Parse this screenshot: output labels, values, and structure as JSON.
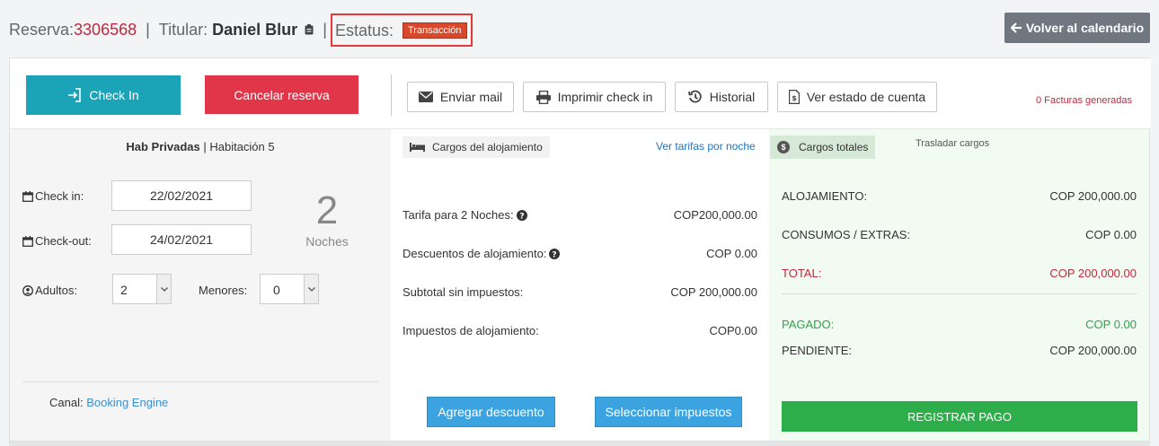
{
  "header": {
    "reserva_label": "Reserva:",
    "reserva_num": "3306568",
    "titular_label": "Titular:",
    "titular_name": "Daniel Blur",
    "estatus_label": "Estatus:",
    "estatus_badge": "Transacción",
    "separator": "|",
    "back_label": "Volver al calendario"
  },
  "toolbar": {
    "checkin_label": "Check In",
    "cancel_label": "Cancelar reserva",
    "mail_label": "Enviar mail",
    "print_label": "Imprimir check in",
    "history_label": "Historial",
    "account_label": "Ver estado de cuenta",
    "facturas": "0 Facturas generadas"
  },
  "left": {
    "room_type": "Hab Privadas",
    "room_sep": " | ",
    "room_name": "Habitación 5",
    "checkin_label": "Check in:",
    "checkin_value": "22/02/2021",
    "checkout_label": "Check-out:",
    "checkout_value": "24/02/2021",
    "nights_number": "2",
    "nights_label": "Noches",
    "adults_label": "Adultos:",
    "adults_value": "2",
    "minors_label": "Menores:",
    "minors_value": "0",
    "canal_label": "Canal:",
    "canal_value": "Booking Engine"
  },
  "middle": {
    "tag_label": "Cargos del alojamiento",
    "tarifas_link": "Ver tarifas por noche",
    "rows": [
      {
        "label": "Tarifa para 2 Noches:",
        "value": "COP200,000.00"
      },
      {
        "label": "Descuentos de alojamiento:",
        "value": "COP 0.00"
      },
      {
        "label": "Subtotal sin impuestos:",
        "value": "COP 200,000.00"
      },
      {
        "label": "Impuestos de alojamiento:",
        "value": "COP0.00"
      }
    ],
    "discount_btn": "Agregar descuento",
    "taxes_btn": "Seleccionar impuestos"
  },
  "right": {
    "tag_label": "Cargos totales",
    "tag_icon": "$",
    "trasladar": "Trasladar cargos",
    "rows": [
      {
        "label": "ALOJAMIENTO:",
        "value": "COP 200,000.00"
      },
      {
        "label": "CONSUMOS / EXTRAS:",
        "value": "COP 0.00"
      },
      {
        "label": "TOTAL:",
        "value": "COP 200,000.00"
      },
      {
        "label": "PAGADO:",
        "value": "COP 0.00"
      },
      {
        "label": "PENDIENTE:",
        "value": "COP 200,000.00"
      }
    ],
    "pay_btn": "REGISTRAR PAGO"
  },
  "colors": {
    "accent_red": "#c0283d",
    "checkin_teal": "#1ba3b8",
    "cancel_red": "#e1364a",
    "pay_green": "#2eae4a",
    "action_blue": "#3aa3e0",
    "badge_orange": "#d9482b"
  }
}
